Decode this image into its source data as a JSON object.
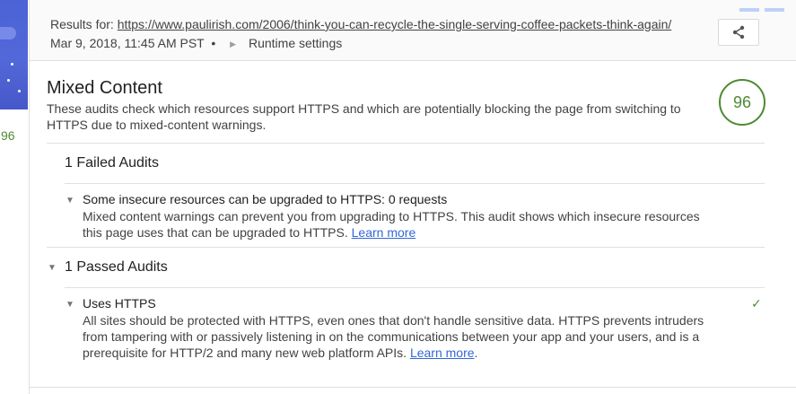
{
  "sidebar": {
    "score": "96"
  },
  "header": {
    "results_label": "Results for:",
    "url": "https://www.paulirish.com/2006/think-you-can-recycle-the-single-serving-coffee-packets-think-again/",
    "timestamp": "Mar 9, 2018, 11:45 AM PST",
    "separator": "•",
    "runtime_settings": "Runtime settings",
    "share_icon": "share-icon"
  },
  "category": {
    "title": "Mixed Content",
    "description": "These audits check which resources support HTTPS and which are potentially blocking the page from switching to HTTPS due to mixed-content warnings.",
    "score": "96",
    "score_color": "#4d8b31"
  },
  "failed_group": {
    "title": "1 Failed Audits",
    "audit": {
      "title": "Some insecure resources can be upgraded to HTTPS: 0 requests",
      "description": "Mixed content warnings can prevent you from upgrading to HTTPS. This audit shows which insecure resources this page uses that can be upgraded to HTTPS.",
      "link": "Learn more",
      "link_suffix": ""
    }
  },
  "passed_group": {
    "title": "1 Passed Audits",
    "audit": {
      "title": "Uses HTTPS",
      "description": "All sites should be protected with HTTPS, even ones that don't handle sensitive data. HTTPS prevents intruders from tampering with or passively listening in on the communications between your app and your users, and is a prerequisite for HTTP/2 and many new web platform APIs.",
      "link": "Learn more",
      "link_suffix": ".",
      "status_icon": "check-icon"
    }
  }
}
